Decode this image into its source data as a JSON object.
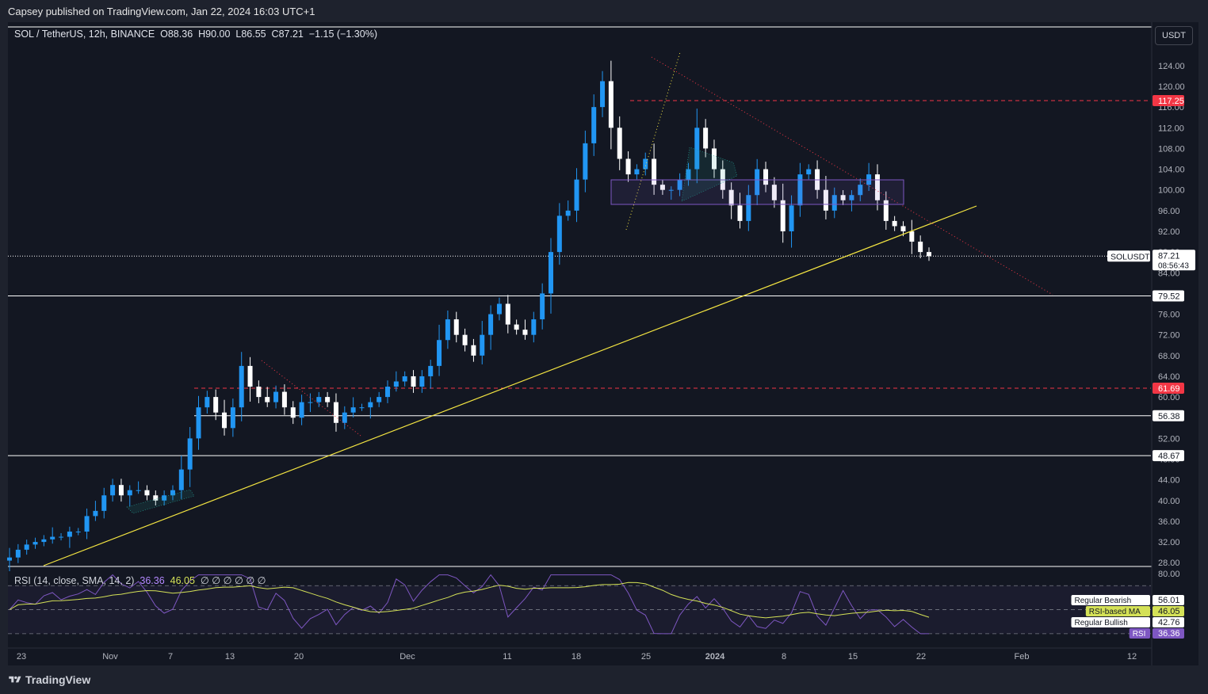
{
  "header": {
    "publisher": "Capsey published on TradingView.com, Jan 22, 2024 16:03 UTC+1"
  },
  "legend": {
    "symbol": "SOL / TetherUS, 12h, BINANCE",
    "open_label": "O",
    "open": "88.36",
    "high_label": "H",
    "high": "90.00",
    "low_label": "L",
    "low": "86.55",
    "close_label": "C",
    "close": "87.21",
    "change": "−1.15 (−1.30%)"
  },
  "currency_button": "USDT",
  "rsi_legend": {
    "label": "RSI (14, close, SMA, 14, 2)",
    "rsi": "36.36",
    "ma": "46.05",
    "extras": "∅ ∅ ∅ ∅ ∅ ∅"
  },
  "footer": {
    "brand": "TradingView"
  },
  "colors": {
    "bg": "#131722",
    "up": "#2196f3",
    "down": "#ffffff",
    "trend": "#f5e642",
    "resistance": "#f23645",
    "rsi": "#7e57c2",
    "rsi_ma": "#d4e157"
  },
  "chart_data": [
    {
      "type": "candlestick",
      "title": "SOL / TetherUS, 12h, BINANCE",
      "y_axis_ticks": [
        "124.00",
        "120.00",
        "116.00",
        "112.00",
        "108.00",
        "104.00",
        "100.00",
        "96.00",
        "92.00",
        "88.00",
        "84.00",
        "80.00",
        "76.00",
        "72.00",
        "68.00",
        "64.00",
        "60.00",
        "56.00",
        "52.00",
        "48.00",
        "44.00",
        "40.00",
        "36.00",
        "32.00",
        "28.00"
      ],
      "x_axis_ticks": [
        "23",
        "Nov",
        "7",
        "13",
        "20",
        "Dec",
        "11",
        "18",
        "25",
        "2024",
        "8",
        "15",
        "22",
        "Feb",
        "12"
      ],
      "ylim": [
        27.5,
        127
      ],
      "last_price": {
        "symbol": "SOLUSDT",
        "price": "87.21",
        "countdown": "08:56:43"
      },
      "horizontal_levels": [
        {
          "label": "117.25",
          "style": "dashed-red"
        },
        {
          "label": "79.52",
          "style": "solid-white"
        },
        {
          "label": "61.69",
          "style": "dashed-red"
        },
        {
          "label": "56.38",
          "style": "solid-white"
        },
        {
          "label": "48.67",
          "style": "solid-white"
        }
      ],
      "price_path": [
        29,
        30.5,
        31.5,
        32,
        32.5,
        33,
        33,
        34,
        34,
        37,
        38,
        41,
        43,
        41,
        42,
        42,
        41,
        40,
        41,
        42,
        46,
        52,
        58,
        60,
        57,
        54,
        58,
        66,
        62,
        60,
        59,
        61,
        58,
        56,
        59,
        59,
        60,
        59,
        55,
        57,
        58,
        58,
        59,
        60,
        62,
        63,
        64,
        62,
        64,
        66,
        71,
        75,
        72,
        70,
        68,
        72,
        76,
        78,
        74,
        73,
        72,
        75,
        80,
        88,
        95,
        96,
        102,
        109,
        116,
        121,
        112,
        106,
        103,
        104,
        106,
        101,
        100,
        100,
        102,
        104,
        112,
        108,
        104,
        100,
        97,
        94,
        99,
        104,
        101,
        98,
        92,
        97,
        103,
        104,
        100,
        96,
        99,
        98,
        99,
        101,
        103,
        98,
        94,
        93,
        92,
        90,
        88,
        87.2
      ]
    },
    {
      "type": "line",
      "title": "RSI (14, close, SMA, 14, 2)",
      "y_axis_ticks": [
        "80.00"
      ],
      "ylim": [
        22,
        84
      ],
      "series": [
        {
          "name": "RSI",
          "current": "36.36"
        },
        {
          "name": "RSI-based MA",
          "current": "46.05"
        }
      ],
      "tags": [
        {
          "label": "Regular Bearish",
          "value": "56.01"
        },
        {
          "label": "RSI-based MA",
          "value": "46.05"
        },
        {
          "label": "Regular Bullish",
          "value": "42.76"
        },
        {
          "label": "RSI",
          "value": "36.36"
        }
      ]
    }
  ]
}
